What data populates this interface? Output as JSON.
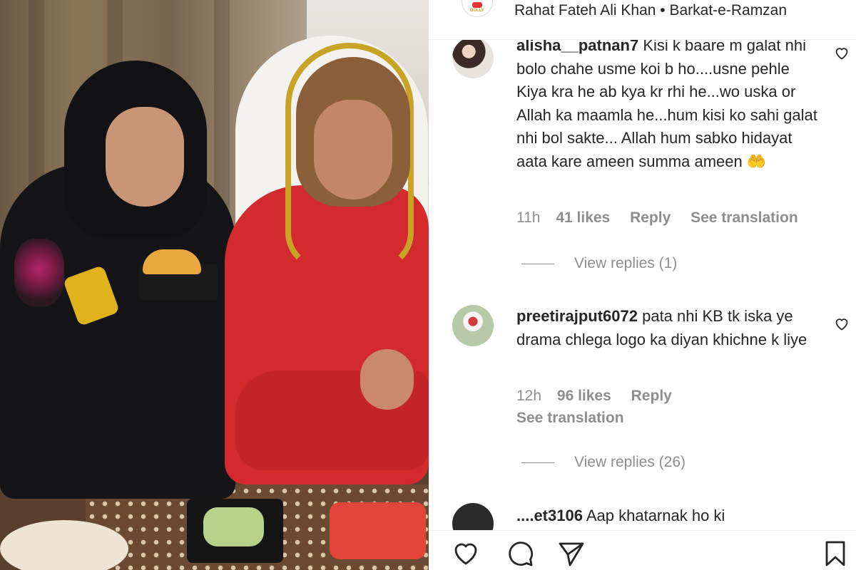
{
  "header": {
    "audio": "Rahat Fateh Ali Khan • Barkat-e-Ramzan",
    "avatar_label": "BOLLY"
  },
  "comments": [
    {
      "username": "alisha__patnan7",
      "text": "Kisi k baare m galat nhi bolo chahe usme koi b ho....usne pehle Kiya kra he ab kya kr rhi he...wo uska or Allah ka maamla he...hum kisi ko sahi galat nhi bol sakte... Allah hum sabko hidayat aata kare ameen summa ameen",
      "emoji": "🤲",
      "time": "11h",
      "likes": "41 likes",
      "reply": "Reply",
      "translation": "See translation",
      "view_replies": "View replies (1)"
    },
    {
      "username": "preetirajput6072",
      "text": "pata nhi KB tk iska ye drama chlega logo ka diyan khichne k liye",
      "time": "12h",
      "likes": "96 likes",
      "reply": "Reply",
      "translation": "See translation",
      "view_replies": "View replies (26)"
    },
    {
      "username": "....et3106",
      "text": "Aap khatarnak ho ki"
    }
  ],
  "icons": {
    "like": "heart-icon",
    "comment": "comment-icon",
    "share": "send-icon",
    "save": "bookmark-icon"
  }
}
